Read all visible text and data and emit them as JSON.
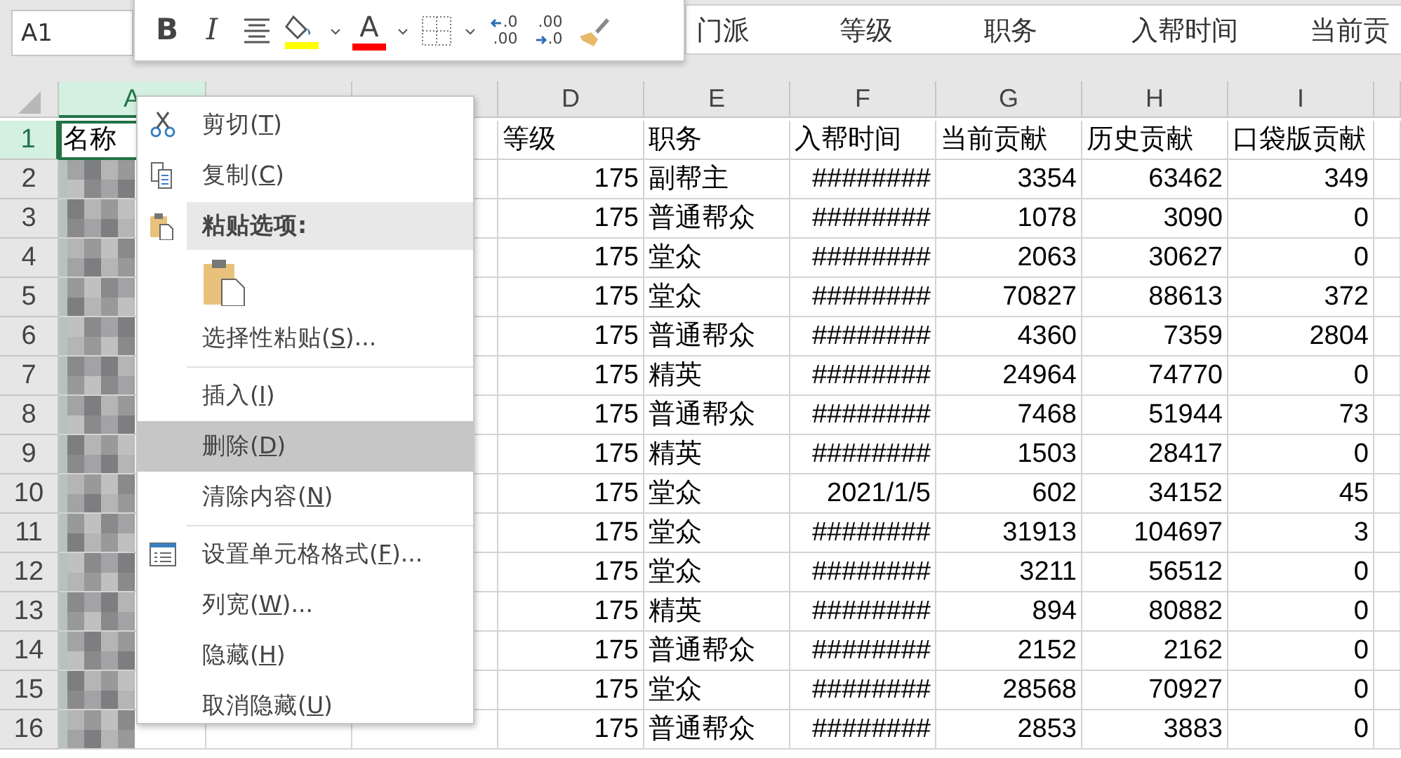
{
  "name_box": "A1",
  "header_strip": [
    "门派",
    "等级",
    "职务",
    "入帮时间",
    "当前贡"
  ],
  "mini_toolbar": [
    {
      "kind": "bold",
      "label": "B"
    },
    {
      "kind": "italic",
      "label": "I"
    },
    {
      "kind": "align"
    },
    {
      "kind": "fill",
      "color": "#ffff00"
    },
    {
      "kind": "caret"
    },
    {
      "kind": "font_color",
      "label": "A",
      "color": "#ff0000"
    },
    {
      "kind": "caret"
    },
    {
      "kind": "borders"
    },
    {
      "kind": "caret"
    },
    {
      "kind": "increase_decimal",
      "top": ".0",
      "bottom": ".00"
    },
    {
      "kind": "decrease_decimal",
      "top": ".00",
      "bottom": ".0"
    },
    {
      "kind": "painter"
    }
  ],
  "columns": [
    {
      "label": "A",
      "selected": true
    },
    {
      "label": "D",
      "selected": false
    },
    {
      "label": "E",
      "selected": false
    },
    {
      "label": "F",
      "selected": false
    },
    {
      "label": "G",
      "selected": false
    },
    {
      "label": "H",
      "selected": false
    },
    {
      "label": "I",
      "selected": false
    }
  ],
  "rows": [
    {
      "number": "1",
      "selected": true,
      "first": "名称",
      "cells": [
        "等级",
        "职务",
        "入帮时间",
        "当前贡献",
        "历史贡献",
        "口袋版贡献"
      ]
    },
    {
      "number": "2",
      "selected": false,
      "redacted": true,
      "cells": [
        "175",
        "副帮主",
        "########",
        "3354",
        "63462",
        "349"
      ]
    },
    {
      "number": "3",
      "selected": false,
      "redacted": true,
      "cells": [
        "175",
        "普通帮众",
        "########",
        "1078",
        "3090",
        "0"
      ]
    },
    {
      "number": "4",
      "selected": false,
      "redacted": true,
      "cells": [
        "175",
        "堂众",
        "########",
        "2063",
        "30627",
        "0"
      ]
    },
    {
      "number": "5",
      "selected": false,
      "redacted": true,
      "cells": [
        "175",
        "堂众",
        "########",
        "70827",
        "88613",
        "372"
      ]
    },
    {
      "number": "6",
      "selected": false,
      "redacted": true,
      "cells": [
        "175",
        "普通帮众",
        "########",
        "4360",
        "7359",
        "2804"
      ]
    },
    {
      "number": "7",
      "selected": false,
      "redacted": true,
      "cells": [
        "175",
        "精英",
        "########",
        "24964",
        "74770",
        "0"
      ]
    },
    {
      "number": "8",
      "selected": false,
      "redacted": true,
      "cells": [
        "175",
        "普通帮众",
        "########",
        "7468",
        "51944",
        "73"
      ]
    },
    {
      "number": "9",
      "selected": false,
      "redacted": true,
      "cells": [
        "175",
        "精英",
        "########",
        "1503",
        "28417",
        "0"
      ]
    },
    {
      "number": "10",
      "selected": false,
      "redacted": true,
      "cells": [
        "175",
        "堂众",
        "2021/1/5",
        "602",
        "34152",
        "45"
      ]
    },
    {
      "number": "11",
      "selected": false,
      "redacted": true,
      "cells": [
        "175",
        "堂众",
        "########",
        "31913",
        "104697",
        "3"
      ]
    },
    {
      "number": "12",
      "selected": false,
      "redacted": true,
      "cells": [
        "175",
        "堂众",
        "########",
        "3211",
        "56512",
        "0"
      ]
    },
    {
      "number": "13",
      "selected": false,
      "redacted": true,
      "cells": [
        "175",
        "精英",
        "########",
        "894",
        "80882",
        "0"
      ]
    },
    {
      "number": "14",
      "selected": false,
      "redacted": true,
      "cells": [
        "175",
        "普通帮众",
        "########",
        "2152",
        "2162",
        "0"
      ]
    },
    {
      "number": "15",
      "selected": false,
      "redacted": true,
      "cells": [
        "175",
        "堂众",
        "########",
        "28568",
        "70927",
        "0"
      ]
    },
    {
      "number": "16",
      "selected": false,
      "redacted": true,
      "cells": [
        "175",
        "普通帮众",
        "########",
        "2853",
        "3883",
        "0"
      ]
    }
  ],
  "context_menu": [
    {
      "kind": "cut",
      "before": "剪切(",
      "key": "T",
      "after": ")",
      "highlighted": false
    },
    {
      "kind": "copy",
      "before": "复制(",
      "key": "C",
      "after": ")",
      "highlighted": false
    },
    {
      "kind": "heading",
      "label": "粘贴选项:"
    },
    {
      "kind": "paste_option"
    },
    {
      "kind": "item",
      "before": "选择性粘贴(",
      "key": "S",
      "after": ")...",
      "highlighted": false
    },
    {
      "kind": "separator"
    },
    {
      "kind": "item",
      "before": "插入(",
      "key": "I",
      "after": ")",
      "highlighted": false
    },
    {
      "kind": "item",
      "before": "删除(",
      "key": "D",
      "after": ")",
      "highlighted": true
    },
    {
      "kind": "item",
      "before": "清除内容(",
      "key": "N",
      "after": ")",
      "highlighted": false
    },
    {
      "kind": "separator"
    },
    {
      "kind": "format",
      "before": "设置单元格格式(",
      "key": "F",
      "after": ")...",
      "highlighted": false
    },
    {
      "kind": "item",
      "before": "列宽(",
      "key": "W",
      "after": ")...",
      "highlighted": false
    },
    {
      "kind": "item",
      "before": "隐藏(",
      "key": "H",
      "after": ")",
      "highlighted": false
    },
    {
      "kind": "item",
      "before": "取消隐藏(",
      "key": "U",
      "after": ")",
      "highlighted": false
    }
  ]
}
